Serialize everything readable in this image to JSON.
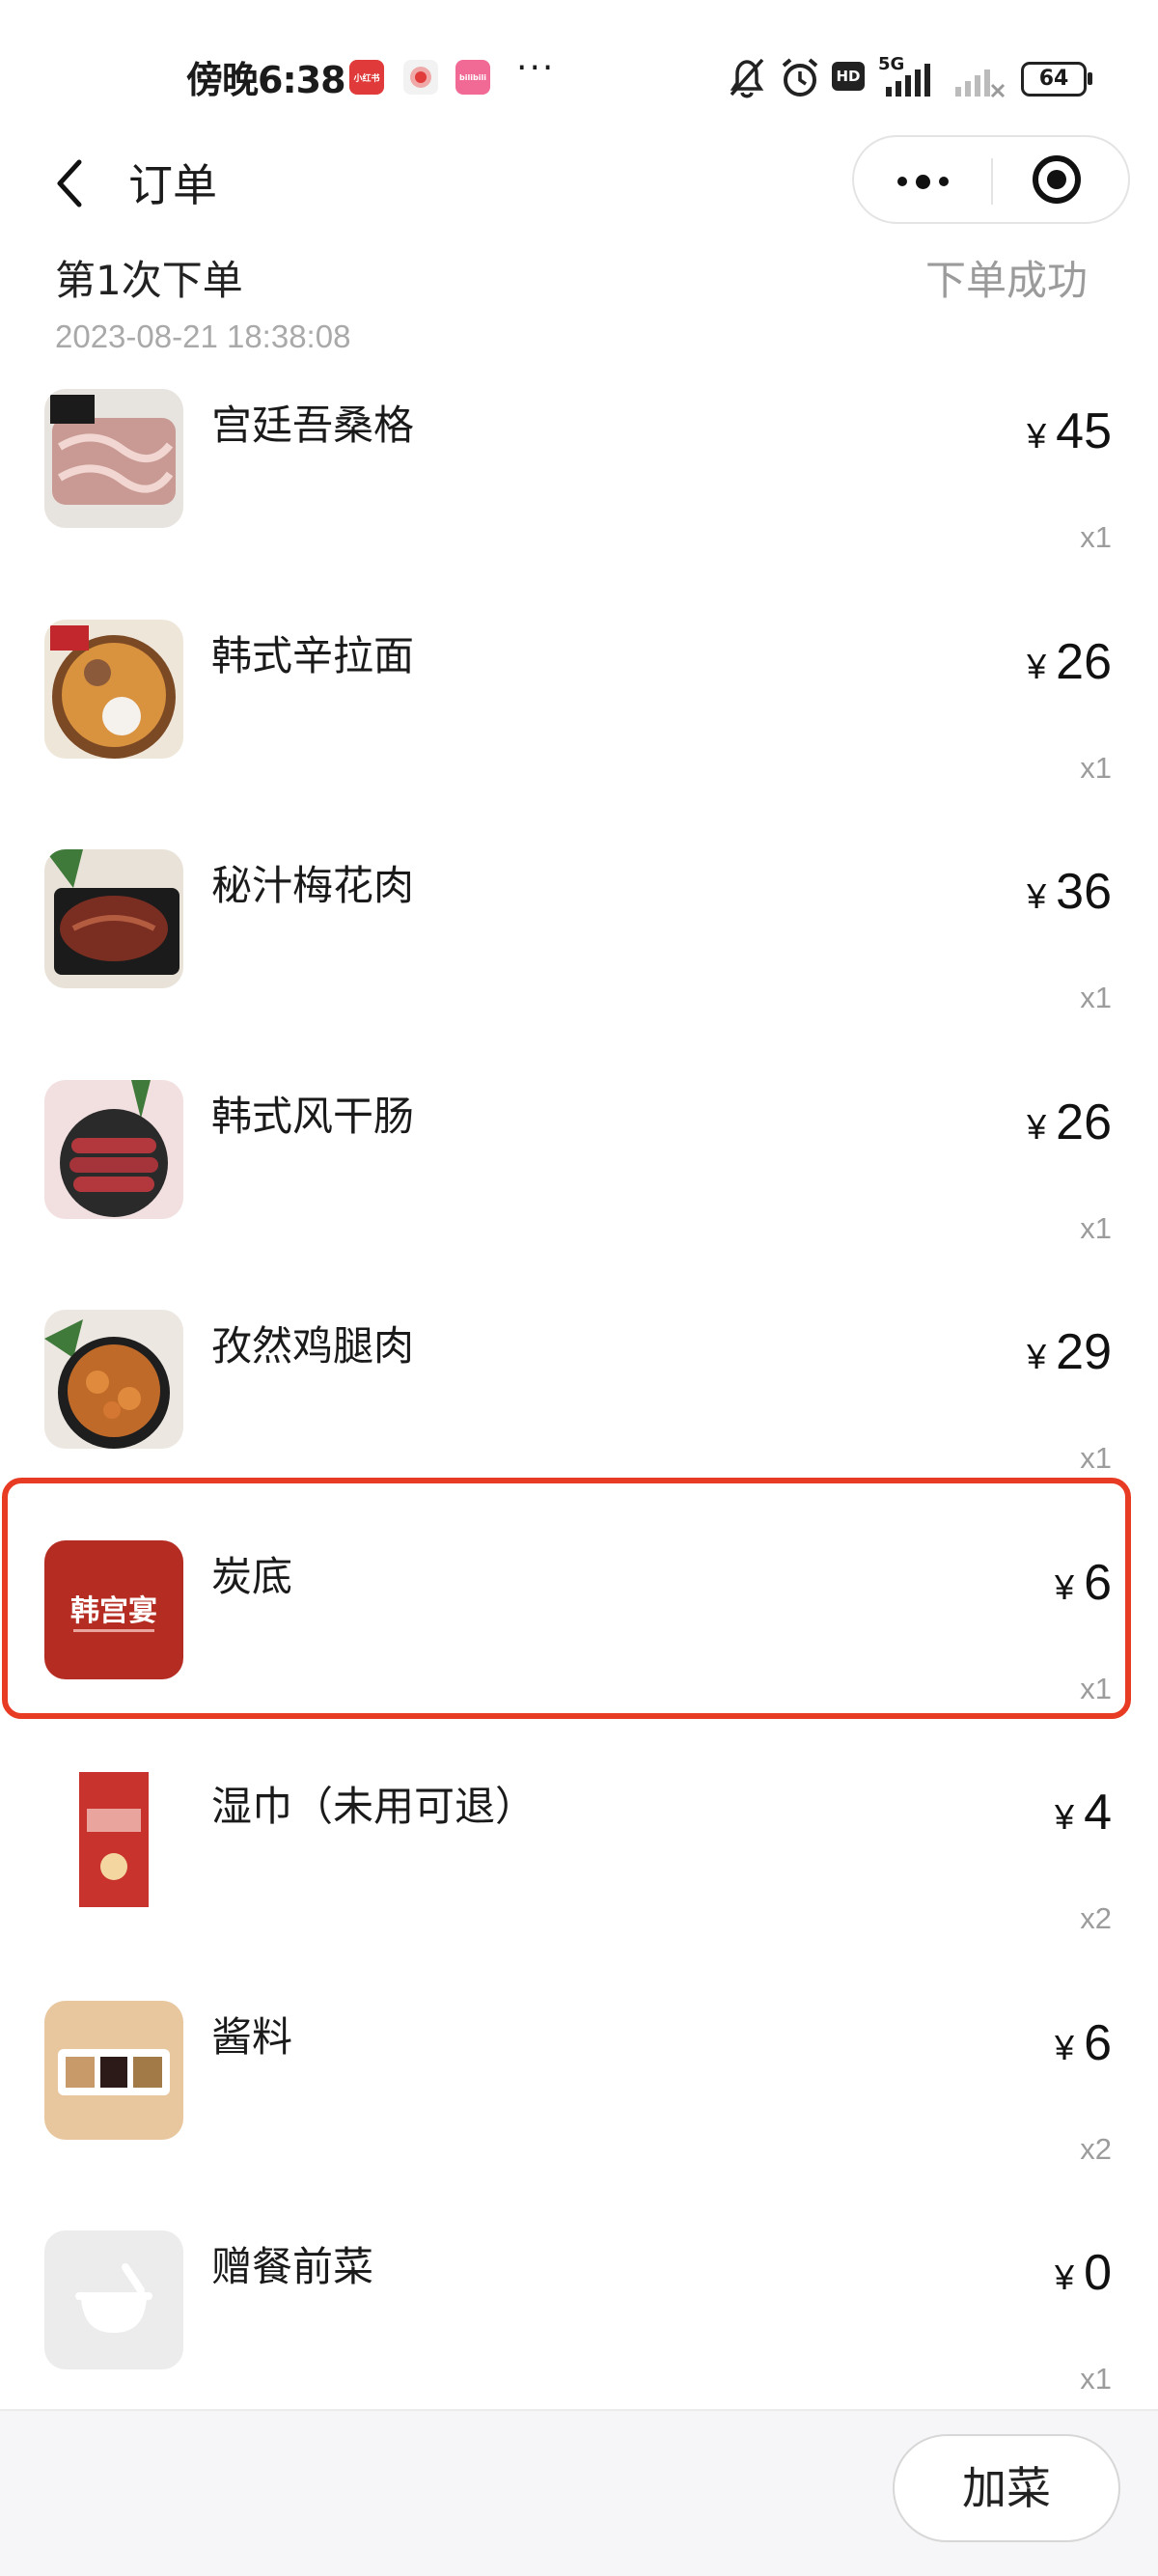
{
  "status_bar": {
    "time": "傍晚6:38",
    "apps": [
      "小红书",
      "",
      "bilibili"
    ],
    "more": "···",
    "network": "5G",
    "hd": "HD",
    "battery": "64"
  },
  "nav": {
    "title": "订单"
  },
  "order": {
    "title": "第1次下单",
    "status": "下单成功",
    "time": "2023-08-21 18:38:08"
  },
  "items": [
    {
      "name": "宫廷吾桑格",
      "price": "45",
      "qty": "x1",
      "thumb_color": "#c99a94"
    },
    {
      "name": "韩式辛拉面",
      "price": "26",
      "qty": "x1",
      "thumb_color": "#c9813d"
    },
    {
      "name": "秘汁梅花肉",
      "price": "36",
      "qty": "x1",
      "thumb_color": "#6b2d22"
    },
    {
      "name": "韩式风干肠",
      "price": "26",
      "qty": "x1",
      "thumb_color": "#a5343a"
    },
    {
      "name": "孜然鸡腿肉",
      "price": "29",
      "qty": "x1",
      "thumb_color": "#c06a2a"
    },
    {
      "name": "炭底",
      "price": "6",
      "qty": "x1",
      "thumb_color": "#b52c22"
    },
    {
      "name": "湿巾（未用可退）",
      "price": "4",
      "qty": "x2",
      "thumb_color": "#c8342d"
    },
    {
      "name": "酱料",
      "price": "6",
      "qty": "x2",
      "thumb_color": "#e8c79f"
    },
    {
      "name": "赠餐前菜",
      "price": "0",
      "qty": "x1",
      "thumb_color": "#ececec"
    }
  ],
  "currency": "¥",
  "logo_text": "韩宫宴",
  "actions": {
    "add_dish": "加菜"
  },
  "colors": {
    "highlight": "#e83b23"
  }
}
